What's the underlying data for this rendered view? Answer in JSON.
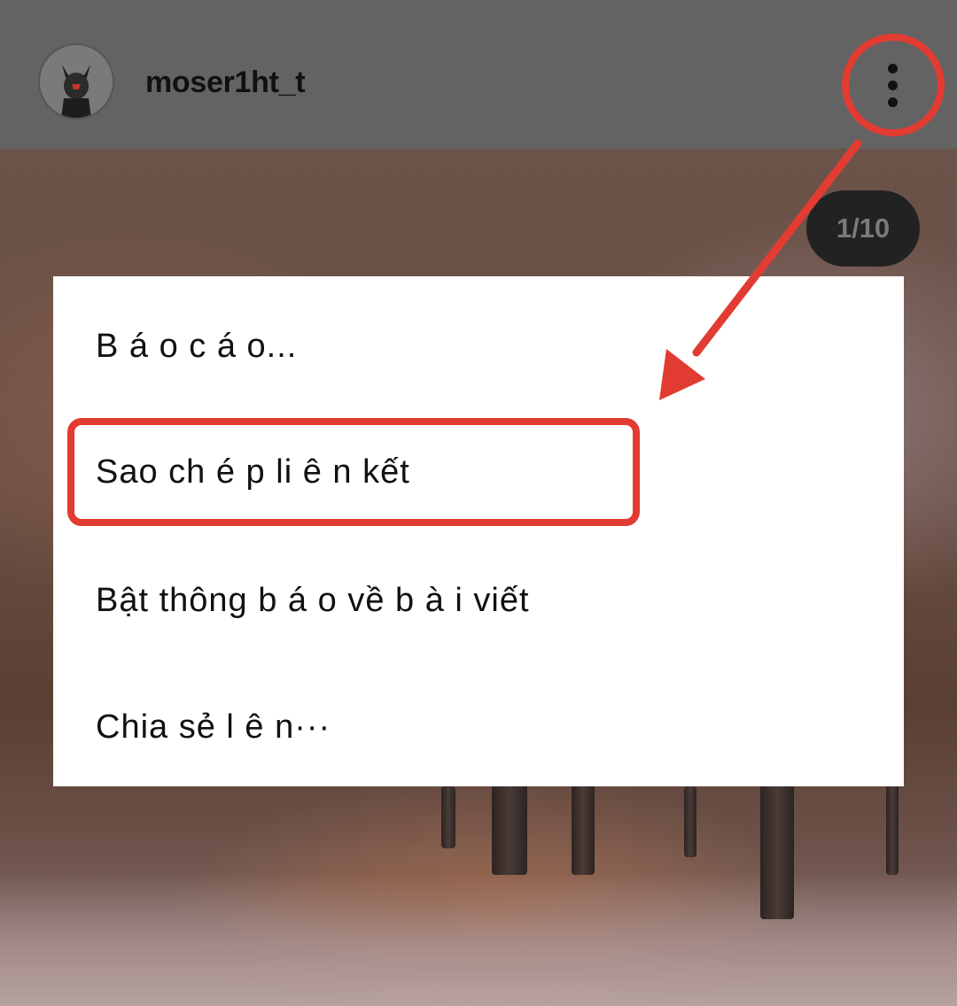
{
  "post": {
    "username": "moser1ht_t",
    "image_counter": "1/10"
  },
  "menu": {
    "items": [
      {
        "label": "B á o c á o..."
      },
      {
        "label": "Sao ch é p li ê n kết"
      },
      {
        "label": "Bật thông b á o về b à i viết"
      },
      {
        "label": "Chia sẻ l ê n···"
      }
    ]
  },
  "icons": {
    "more": "more-vertical-icon",
    "avatar": "user-avatar"
  },
  "colors": {
    "header": "#636363",
    "annotation": "#e23c32",
    "menu_background": "#ffffff",
    "counter_pill": "#222222"
  }
}
